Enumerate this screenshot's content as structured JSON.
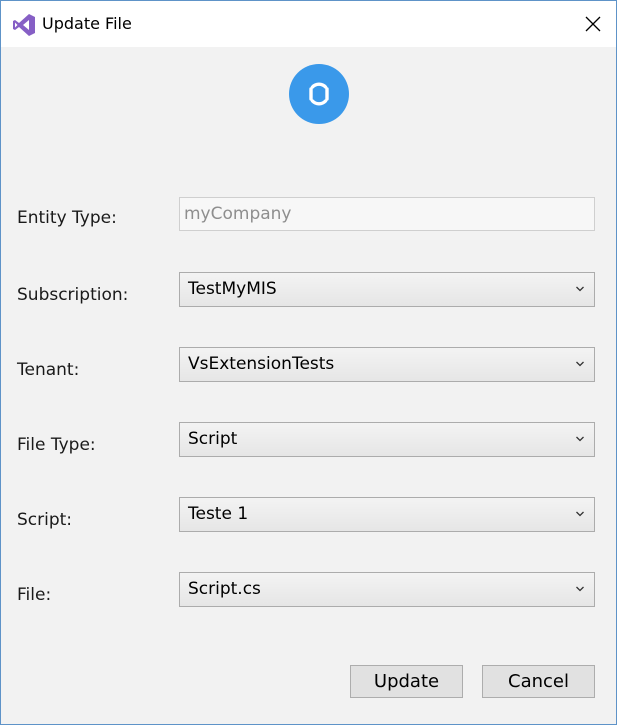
{
  "window": {
    "title": "Update File",
    "accent_color": "#3a99ea",
    "icon_color": "#865fc5"
  },
  "form": {
    "entity_type": {
      "label": "Entity Type:",
      "value": "myCompany"
    },
    "subscription": {
      "label": "Subscription:",
      "value": "TestMyMIS"
    },
    "tenant": {
      "label": "Tenant:",
      "value": "VsExtensionTests"
    },
    "file_type": {
      "label": "File Type:",
      "value": "Script"
    },
    "script": {
      "label": "Script:",
      "value": "Teste 1"
    },
    "file": {
      "label": "File:",
      "value": "Script.cs"
    }
  },
  "actions": {
    "update_label": "Update",
    "cancel_label": "Cancel"
  }
}
